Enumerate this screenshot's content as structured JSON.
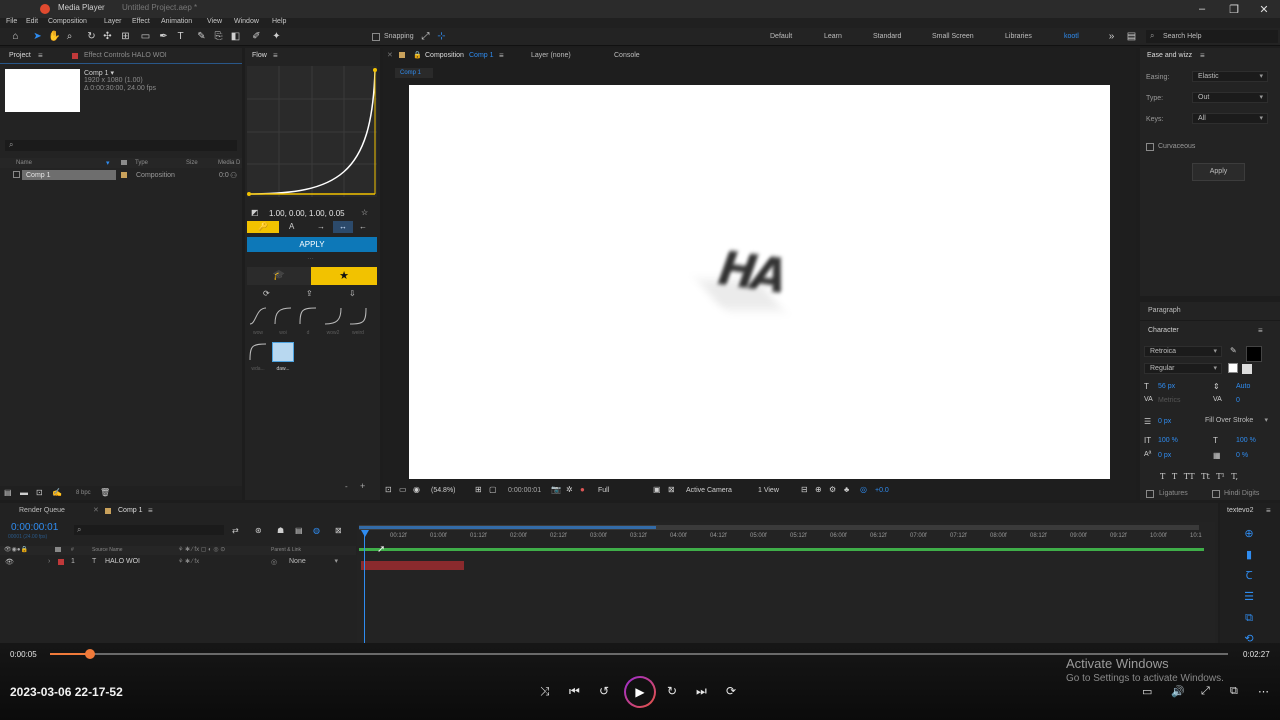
{
  "window": {
    "title": "Media Player",
    "project_file": "Untitled Project.aep *"
  },
  "menu": [
    "File",
    "Edit",
    "Composition",
    "Layer",
    "Effect",
    "Animation",
    "View",
    "Window",
    "Help"
  ],
  "toolbar": {
    "snapping_label": "Snapping",
    "workspaces": [
      "Default",
      "Learn",
      "Standard",
      "Small Screen",
      "Libraries",
      "kootl"
    ],
    "active_workspace": "kootl",
    "search_placeholder": "Search Help"
  },
  "project_panel": {
    "tab_project": "Project",
    "tab_effect_controls": "Effect Controls HALO WOI",
    "comp_name": "Comp 1 ▾",
    "comp_res": "1920 x 1080 (1.00)",
    "comp_duration": "Δ 0:00:30:00, 24.00 fps",
    "columns": [
      "Name",
      "Type",
      "Size",
      "Media D"
    ],
    "items": [
      {
        "name": "Comp 1",
        "type": "Composition",
        "media": "0:0"
      }
    ],
    "bpc": "8 bpc"
  },
  "flow_panel": {
    "tab": "Flow",
    "values": "1.00, 0.00, 1.00, 0.05",
    "apply_label": "APPLY",
    "presets": [
      "wow",
      "woi",
      "d",
      "wow2",
      "weird",
      "wda...",
      "daw..."
    ]
  },
  "comp_panel": {
    "tab_comp": "Composition",
    "tab_comp_name": "Comp 1",
    "tab_layer": "Layer (none)",
    "tab_console": "Console",
    "breadcrumb": "Comp 1",
    "canvas_text": "HA",
    "zoom": "(54.8%)",
    "timecode": "0:00:00:01",
    "resolution": "Full",
    "camera": "Active Camera",
    "view": "1 View",
    "exposure": "+0.0"
  },
  "ease_panel": {
    "tab": "Ease and wizz",
    "easing_label": "Easing:",
    "easing_value": "Elastic",
    "type_label": "Type:",
    "type_value": "Out",
    "keys_label": "Keys:",
    "keys_value": "All",
    "curvaceous_label": "Curvaceous",
    "apply_label": "Apply"
  },
  "paragraph_panel": {
    "tab": "Paragraph"
  },
  "character_panel": {
    "tab": "Character",
    "font": "Retroica",
    "style": "Regular",
    "font_size": "56 px",
    "leading": "Auto",
    "kerning": "Metrics",
    "tracking": "0",
    "stroke_width": "0 px",
    "stroke_type": "Fill Over Stroke",
    "vert_scale": "100 %",
    "horiz_scale": "100 %",
    "baseline": "0 px",
    "tsume": "0 %",
    "ligatures_label": "Ligatures",
    "hindi_label": "Hindi Digits"
  },
  "timeline": {
    "tab_render": "Render Queue",
    "tab_comp": "Comp 1",
    "timecode": "0:00:00:01",
    "fps_info": "00001 (24.00 fps)",
    "columns": [
      "#",
      "Source Name",
      "Parent & Link"
    ],
    "layer": {
      "index": "1",
      "name": "HALO WOI",
      "parent": "None"
    },
    "ruler": [
      "00:12f",
      "01:00f",
      "01:12f",
      "02:00f",
      "02:12f",
      "03:00f",
      "03:12f",
      "04:00f",
      "04:12f",
      "05:00f",
      "05:12f",
      "06:00f",
      "06:12f",
      "07:00f",
      "07:12f",
      "08:00f",
      "08:12f",
      "09:00f",
      "09:12f",
      "10:00f",
      "10:1"
    ],
    "toggle_label": "Toggle Switches / Modes",
    "side_tab": "textevo2"
  },
  "player": {
    "current_time": "0:00:05",
    "total_time": "0:02:27",
    "progress": 0.034,
    "filename": "2023-03-06 22-17-52"
  },
  "watermark": {
    "title": "Activate Windows",
    "subtitle": "Go to Settings to activate Windows."
  },
  "colors": {
    "accent_blue": "#2f8cf0",
    "accent_yellow": "#f2c200",
    "apply_blue": "#0d78b8",
    "progress_orange": "#f07a3a",
    "layer_red": "#c0393a"
  }
}
